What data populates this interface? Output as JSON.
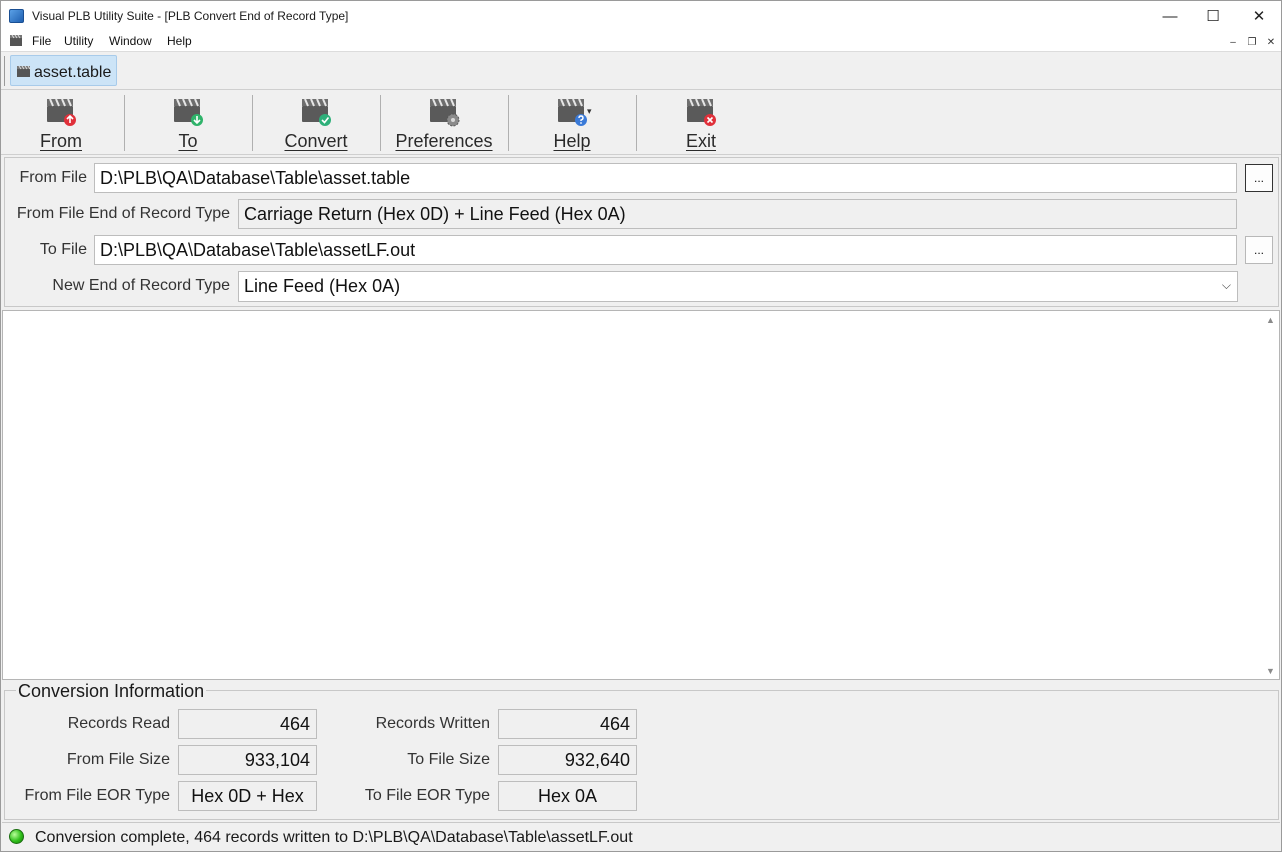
{
  "window": {
    "title": "Visual PLB Utility Suite - [PLB Convert End of Record Type]",
    "minimize": "—",
    "maximize": "☐",
    "close": "✕"
  },
  "menu": {
    "items": [
      "File",
      "Utility",
      "Window",
      "Help"
    ],
    "mdi_minimize": "–",
    "mdi_restore": "❐",
    "mdi_close": "✕"
  },
  "doc_tab": {
    "label": "asset.table"
  },
  "toolbar": {
    "buttons": [
      {
        "label": "From",
        "icon": "clapper-from-icon"
      },
      {
        "label": "To",
        "icon": "clapper-to-icon"
      },
      {
        "label": "Convert",
        "icon": "clapper-convert-icon"
      },
      {
        "label": "Preferences",
        "icon": "clapper-preferences-icon"
      },
      {
        "label": "Help",
        "icon": "clapper-help-icon"
      },
      {
        "label": "Exit",
        "icon": "clapper-exit-icon"
      }
    ],
    "help_dropdown": "▾"
  },
  "files": {
    "from_file_label": "From File",
    "from_file_value": "D:\\PLB\\QA\\Database\\Table\\asset.table",
    "from_eor_label": "From File End of Record Type",
    "from_eor_value": "Carriage Return (Hex 0D) + Line Feed (Hex 0A)",
    "to_file_label": "To File",
    "to_file_value": "D:\\PLB\\QA\\Database\\Table\\assetLF.out",
    "new_eor_label": "New End of Record Type",
    "new_eor_value": "Line Feed (Hex 0A)",
    "browse_label": "...",
    "dropdown_arrow": "⌵"
  },
  "scroll": {
    "up": "▲",
    "down": "▼"
  },
  "conversion": {
    "title": "Conversion Information",
    "records_read_label": "Records Read",
    "records_read": "464",
    "records_written_label": "Records Written",
    "records_written": "464",
    "from_size_label": "From File Size",
    "from_size": "933,104",
    "to_size_label": "To File Size",
    "to_size": "932,640",
    "from_eor_label": "From File EOR Type",
    "from_eor": "Hex 0D + Hex",
    "to_eor_label": "To File EOR Type",
    "to_eor": "Hex 0A"
  },
  "status": {
    "text": "Conversion complete, 464 records written to D:\\PLB\\QA\\Database\\Table\\assetLF.out",
    "led_color": "#2fbf1a"
  }
}
